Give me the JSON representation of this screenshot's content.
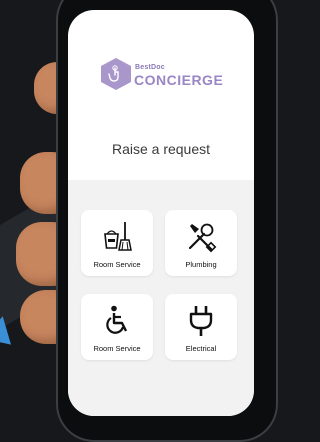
{
  "brand": {
    "small_label": "BestDoc",
    "name": "CONCIERGE",
    "accent": "#9a86c4"
  },
  "page": {
    "title": "Raise a request"
  },
  "services": [
    {
      "label": "Room Service",
      "icon": "cleaning-bucket-broom-icon"
    },
    {
      "label": "Plumbing",
      "icon": "wrench-screwdriver-icon"
    },
    {
      "label": "Room Service",
      "icon": "wheelchair-icon"
    },
    {
      "label": "Electrical",
      "icon": "power-plug-icon"
    }
  ]
}
